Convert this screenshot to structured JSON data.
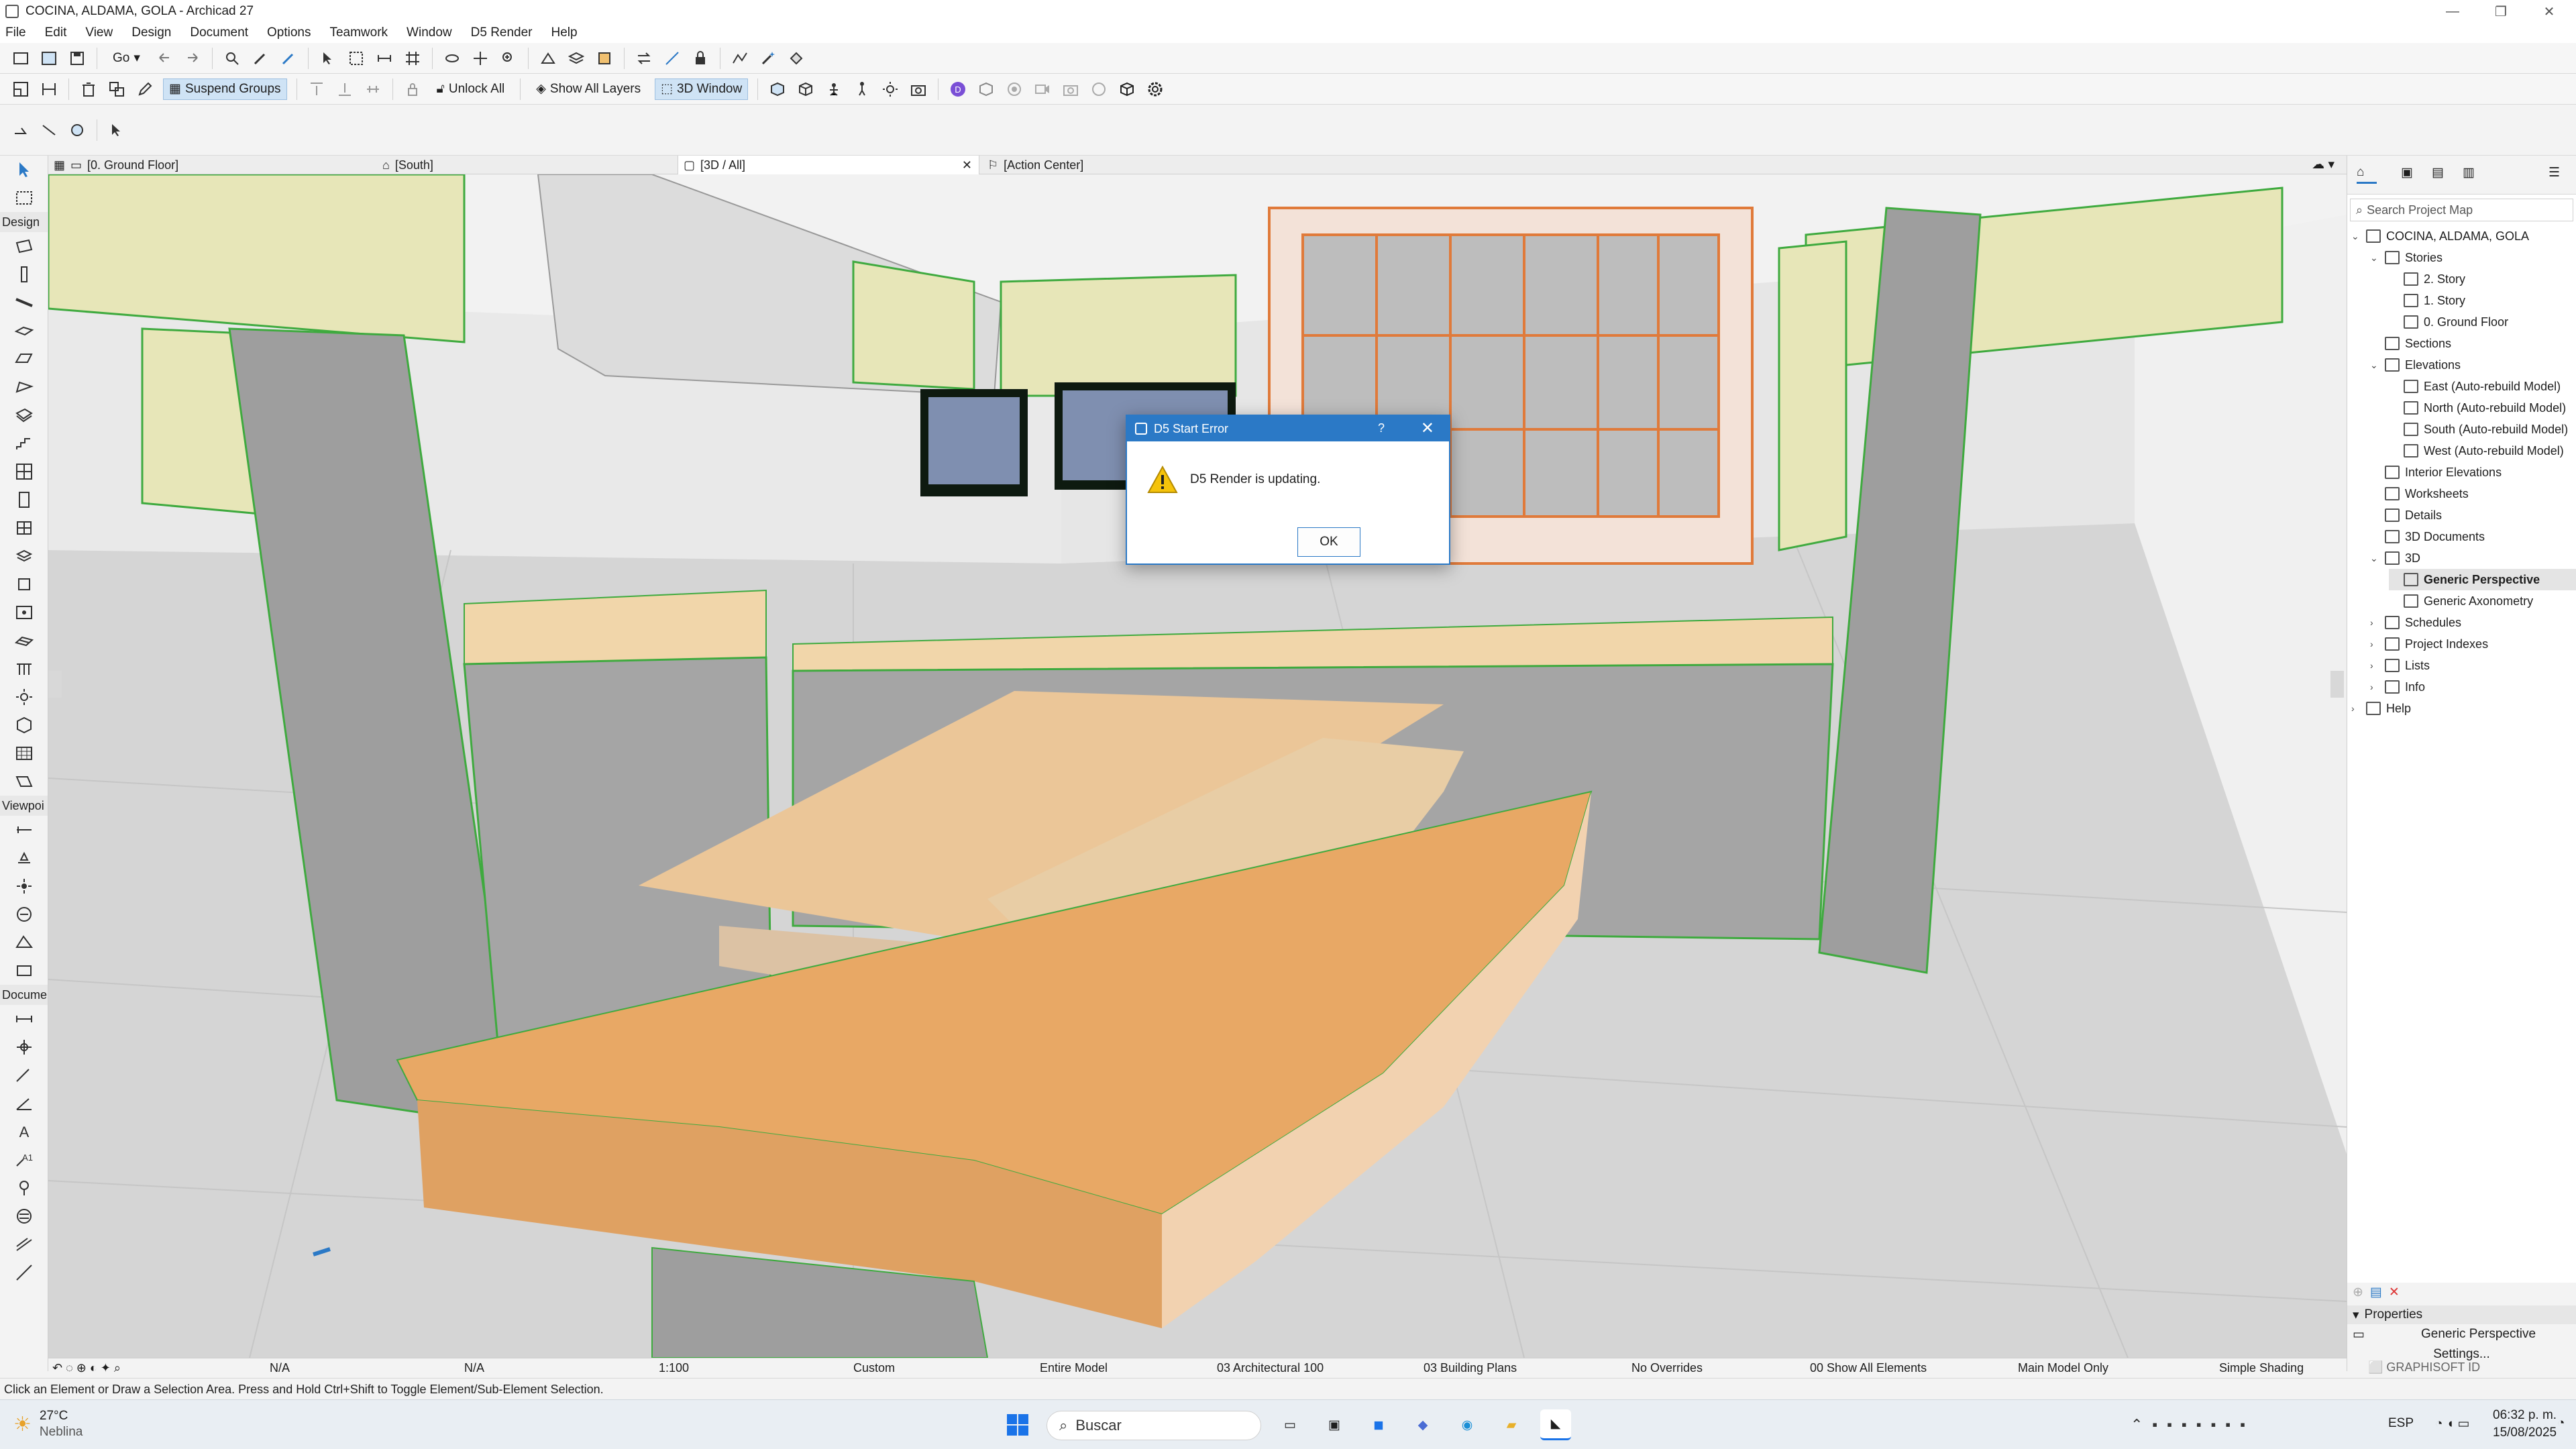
{
  "window": {
    "title": "COCINA, ALDAMA, GOLA - Archicad 27"
  },
  "menu": [
    "File",
    "Edit",
    "View",
    "Design",
    "Document",
    "Options",
    "Teamwork",
    "Window",
    "D5 Render",
    "Help"
  ],
  "toolbar2": {
    "go_label": "Go",
    "suspend_groups": "Suspend Groups",
    "unlock_all": "Unlock All",
    "show_all_layers": "Show All Layers",
    "window_3d": "3D Window"
  },
  "toolbox": {
    "design_header": "Design",
    "viewpoint_header": "Viewpoi",
    "document_header": "Docume"
  },
  "tabs": [
    {
      "label": "[0. Ground Floor]"
    },
    {
      "label": "[South]"
    },
    {
      "label": "[3D / All]"
    },
    {
      "label": "[Action Center]"
    }
  ],
  "dialog": {
    "title": "D5 Start Error",
    "help": "?",
    "message": "D5 Render is updating.",
    "ok": "OK"
  },
  "navigator": {
    "search_placeholder": "Search Project Map",
    "tree": [
      {
        "label": "COCINA, ALDAMA, GOLA",
        "level": 0,
        "caret": "down"
      },
      {
        "label": "Stories",
        "level": 1,
        "caret": "down"
      },
      {
        "label": "2. Story",
        "level": 2
      },
      {
        "label": "1. Story",
        "level": 2
      },
      {
        "label": "0. Ground Floor",
        "level": 2
      },
      {
        "label": "Sections",
        "level": 1
      },
      {
        "label": "Elevations",
        "level": 1,
        "caret": "down"
      },
      {
        "label": "East (Auto-rebuild Model)",
        "level": 2
      },
      {
        "label": "North (Auto-rebuild Model)",
        "level": 2
      },
      {
        "label": "South (Auto-rebuild Model)",
        "level": 2
      },
      {
        "label": "West (Auto-rebuild Model)",
        "level": 2
      },
      {
        "label": "Interior Elevations",
        "level": 1
      },
      {
        "label": "Worksheets",
        "level": 1
      },
      {
        "label": "Details",
        "level": 1
      },
      {
        "label": "3D Documents",
        "level": 1
      },
      {
        "label": "3D",
        "level": 1,
        "caret": "down"
      },
      {
        "label": "Generic Perspective",
        "level": 2,
        "selected": true
      },
      {
        "label": "Generic Axonometry",
        "level": 2
      },
      {
        "label": "Schedules",
        "level": 1,
        "caret": "right"
      },
      {
        "label": "Project Indexes",
        "level": 1,
        "caret": "right"
      },
      {
        "label": "Lists",
        "level": 1,
        "caret": "right"
      },
      {
        "label": "Info",
        "level": 1,
        "caret": "right"
      },
      {
        "label": "Help",
        "level": 0,
        "caret": "right"
      }
    ]
  },
  "properties": {
    "header": "Properties",
    "view_name": "Generic Perspective",
    "settings": "Settings...",
    "brand": "GRAPHISOFT ID"
  },
  "statusbar": {
    "na1": "N/A",
    "na2": "N/A",
    "scale": "1:100",
    "custom": "Custom",
    "entire_model": "Entire Model",
    "pen_set": "03 Architectural 100",
    "mvo": "03 Building Plans",
    "overrides": "No Overrides",
    "renovation": "00 Show All Elements",
    "model_only": "Main Model Only",
    "shading": "Simple Shading"
  },
  "hint": "Click an Element or Draw a Selection Area. Press and Hold Ctrl+Shift to Toggle Element/Sub-Element Selection.",
  "taskbar": {
    "temp": "27°C",
    "weather": "Neblina",
    "search": "Buscar",
    "lang": "ESP",
    "time": "06:32 p. m.",
    "date": "15/08/2025"
  },
  "colors": {
    "accent": "#2b79c6",
    "counter": "#e8a865",
    "cabinet": "#e7e6b8",
    "wall": "#9e9e9e",
    "outline": "#3faa3f"
  }
}
